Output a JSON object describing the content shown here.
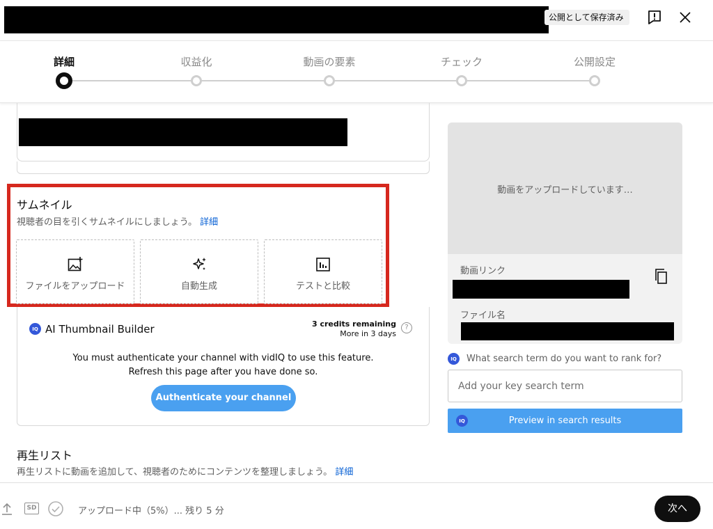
{
  "header": {
    "save_status": "公開として保存済み",
    "feedback_icon": "exclamation-feedback-icon",
    "close_icon": "close-x-icon"
  },
  "stepper": {
    "steps": [
      {
        "label": "詳細",
        "active": true
      },
      {
        "label": "収益化",
        "active": false
      },
      {
        "label": "動画の要素",
        "active": false
      },
      {
        "label": "チェック",
        "active": false
      },
      {
        "label": "公開設定",
        "active": false
      }
    ]
  },
  "thumbnail": {
    "title": "サムネイル",
    "subtitle": "視聴者の目を引くサムネイルにしましょう。",
    "details_link": "詳細",
    "options": [
      {
        "label": "ファイルをアップロード",
        "icon": "image-add-icon"
      },
      {
        "label": "自動生成",
        "icon": "sparkle-icon"
      },
      {
        "label": "テストと比較",
        "icon": "bar-chart-icon"
      }
    ]
  },
  "ai_builder": {
    "title": "AI Thumbnail Builder",
    "credits": "3 credits remaining",
    "credits_refresh": "More in 3 days",
    "message_line1": "You must authenticate your channel with vidIQ to use this feature.",
    "message_line2": "Refresh this page after you have done so.",
    "auth_button": "Authenticate your channel",
    "logo_text": "IQ"
  },
  "playlist": {
    "title": "再生リスト",
    "subtitle": "再生リストに動画を追加して、視聴者のためにコンテンツを整理しましょう。",
    "details_link": "詳細"
  },
  "preview": {
    "uploading": "動画をアップロードしています…",
    "video_link_label": "動画リンク",
    "filename_label": "ファイル名"
  },
  "search_rank": {
    "question": "What search term do you want to rank for?",
    "placeholder": "Add your key search term",
    "preview_button": "Preview in search results"
  },
  "footer": {
    "status": "アップロード中（5%）... 残り 5 分",
    "next_button": "次へ",
    "hd_badge": "SD"
  },
  "colors": {
    "accent_blue": "#4aa0f0",
    "link_blue": "#065fd4",
    "highlight_red": "#d6281e",
    "vidiq_blue": "#3458d9"
  }
}
